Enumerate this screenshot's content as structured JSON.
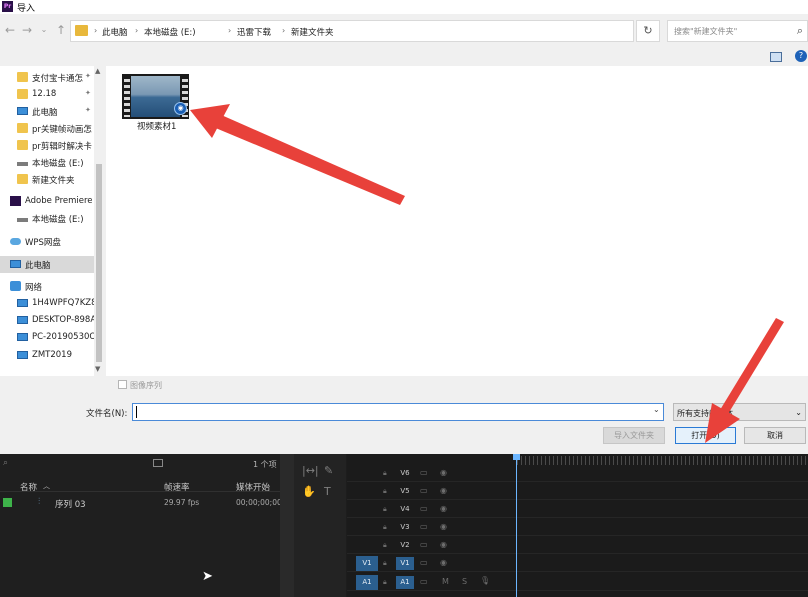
{
  "dialog": {
    "title": "导入",
    "app_icon": "Pr",
    "breadcrumb": [
      "此电脑",
      "本地磁盘 (E:)",
      "迅雷下载",
      "新建文件夹"
    ],
    "search_placeholder": "搜索\"新建文件夹\"",
    "nav": [
      {
        "label": "支付宝卡通怎",
        "icon": "folder-icon",
        "pinned": true
      },
      {
        "label": "12.18",
        "icon": "folder-icon",
        "pinned": true
      },
      {
        "label": "此电脑",
        "icon": "pc-icon",
        "pinned": true
      },
      {
        "label": "pr关键帧动画怎",
        "icon": "folder-icon",
        "pinned": true
      },
      {
        "label": "pr剪辑时解决卡",
        "icon": "folder-icon",
        "pinned": true
      },
      {
        "label": "本地磁盘 (E:)",
        "icon": "drive-icon",
        "pinned": false
      },
      {
        "label": "新建文件夹",
        "icon": "folder-icon",
        "pinned": false
      },
      {
        "label": "Adobe Premiere",
        "icon": "premiere-icon",
        "pinned": false
      },
      {
        "label": "本地磁盘 (E:)",
        "icon": "drive-icon",
        "pinned": false
      },
      {
        "label": "WPS网盘",
        "icon": "cloud-icon",
        "pinned": false
      },
      {
        "label": "此电脑",
        "icon": "pc-icon",
        "pinned": false
      },
      {
        "label": "网络",
        "icon": "network-icon",
        "pinned": false
      },
      {
        "label": "1H4WPFQ7KZ8",
        "icon": "pc-icon",
        "pinned": false
      },
      {
        "label": "DESKTOP-898A",
        "icon": "pc-icon",
        "pinned": false
      },
      {
        "label": "PC-20190530O",
        "icon": "pc-icon",
        "pinned": false
      },
      {
        "label": "ZMT2019",
        "icon": "pc-icon",
        "pinned": false
      }
    ],
    "file": {
      "name": "视频素材1"
    },
    "image_sequence_label": "图像序列",
    "filename_label": "文件名(N):",
    "filename_value": "",
    "filetype_value": "所有支持的媒体",
    "buttons": {
      "import_folder": "导入文件夹",
      "open": "打开(O)",
      "cancel": "取消"
    }
  },
  "premiere": {
    "project": {
      "item_count": "1 个项",
      "columns": [
        "名称",
        "帧速率",
        "媒体开始"
      ],
      "rows": [
        {
          "name": "序列 03",
          "fps": "29.97 fps",
          "start": "00;00;00;00"
        }
      ]
    },
    "tracks": [
      {
        "label": "V6",
        "src": ""
      },
      {
        "label": "V5",
        "src": ""
      },
      {
        "label": "V4",
        "src": ""
      },
      {
        "label": "V3",
        "src": ""
      },
      {
        "label": "V2",
        "src": ""
      },
      {
        "label": "V1",
        "src": "V1"
      },
      {
        "label": "A1",
        "src": "A1"
      }
    ]
  },
  "colors": {
    "annotation": "#e8413a",
    "accent": "#2a7ad5",
    "label_green": "#3eb34a"
  }
}
